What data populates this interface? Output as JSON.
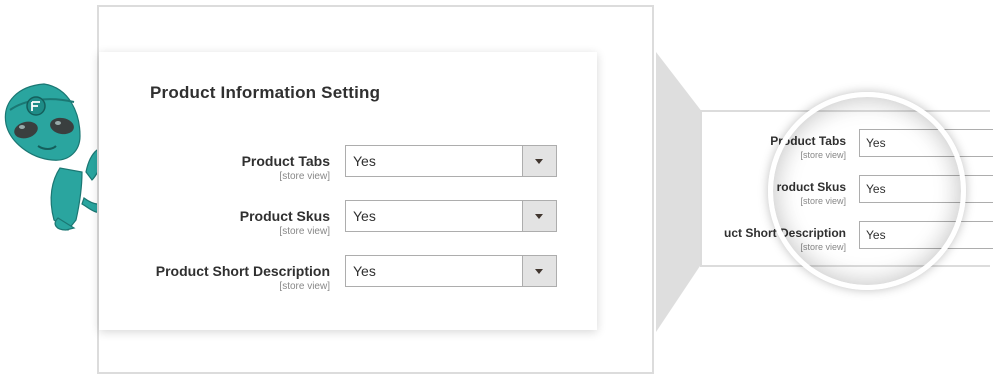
{
  "panel": {
    "title": "Product Information Setting",
    "fields": [
      {
        "label": "Product Tabs",
        "scope": "[store view]",
        "value": "Yes"
      },
      {
        "label": "Product Skus",
        "scope": "[store view]",
        "value": "Yes"
      },
      {
        "label": "Product Short Description",
        "scope": "[store view]",
        "value": "Yes"
      }
    ]
  },
  "zoom": {
    "fields": [
      {
        "label": "Product Tabs",
        "scope": "[store view]",
        "value": "Yes"
      },
      {
        "label": "roduct Skus",
        "scope": "[store view]",
        "value": "Yes"
      },
      {
        "label": "uct Short Description",
        "scope": "[store view]",
        "value": "Yes"
      }
    ]
  },
  "colors": {
    "accent": "#2aa59f",
    "frame": "#dcdcdc",
    "connector": "#dedede",
    "dropdown_arrow_bg": "#e3e3e3"
  },
  "icons": {
    "dropdown": "chevron-down-icon",
    "mascot": "alien-mascot-icon"
  }
}
